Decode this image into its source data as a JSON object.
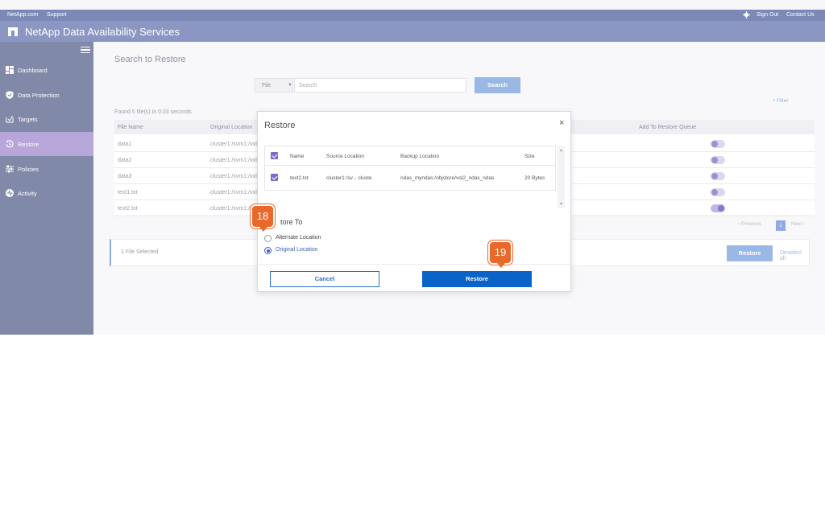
{
  "topbar": {
    "netapp_link": "NetApp.com",
    "support_link": "Support",
    "sign_out": "Sign Out",
    "contact_us": "Contact Us"
  },
  "app": {
    "title": "NetApp Data Availability Services"
  },
  "sidebar": {
    "items": [
      {
        "label": "Dashboard",
        "icon": "dashboard-icon"
      },
      {
        "label": "Data Protection",
        "icon": "shield-icon"
      },
      {
        "label": "Targets",
        "icon": "target-icon"
      },
      {
        "label": "Restore",
        "icon": "history-icon",
        "active": true
      },
      {
        "label": "Policies",
        "icon": "sliders-icon"
      },
      {
        "label": "Activity",
        "icon": "activity-icon"
      }
    ]
  },
  "search": {
    "title": "Search to Restore",
    "type_selected": "File",
    "placeholder": "Search",
    "button": "Search",
    "filter": "Filter",
    "found_text": "Found 5 file(s) in 0.03 seconds"
  },
  "results": {
    "columns": [
      "File Name",
      "Original Location",
      "Add To Restore Queue"
    ],
    "rows": [
      {
        "name": "data1",
        "location": "cluster1:/svm1:/vol",
        "queued": false
      },
      {
        "name": "data2",
        "location": "cluster1:/svm1:/vol",
        "queued": false
      },
      {
        "name": "data3",
        "location": "cluster1:/svm1:/vol",
        "queued": false
      },
      {
        "name": "text1.txt",
        "location": "cluster1:/svm1:/vol",
        "queued": false
      },
      {
        "name": "text2.txt",
        "location": "cluster1:/svm1:/vol",
        "queued": true
      }
    ]
  },
  "pagination": {
    "previous": "Previous",
    "page": "1",
    "next": "Next"
  },
  "selection": {
    "text": "1 File Selected",
    "restore": "Restore",
    "deselect": "Deselect all"
  },
  "modal": {
    "title": "Restore",
    "columns": {
      "name": "Name",
      "source": "Source Location",
      "backup": "Backup Location",
      "size": "Size"
    },
    "row": {
      "name": "text2.txt",
      "source": "cluster1:/sv... cluste",
      "backup": "ndas_myndas:/objstore/vol2_ndas_ndas",
      "size": "20 Bytes"
    },
    "restore_to_label": "tore To",
    "options": [
      {
        "label": "Alternate Location",
        "selected": false
      },
      {
        "label": "Original Location",
        "selected": true
      }
    ],
    "cancel": "Cancel",
    "restore": "Restore"
  },
  "callouts": [
    "18",
    "19"
  ]
}
